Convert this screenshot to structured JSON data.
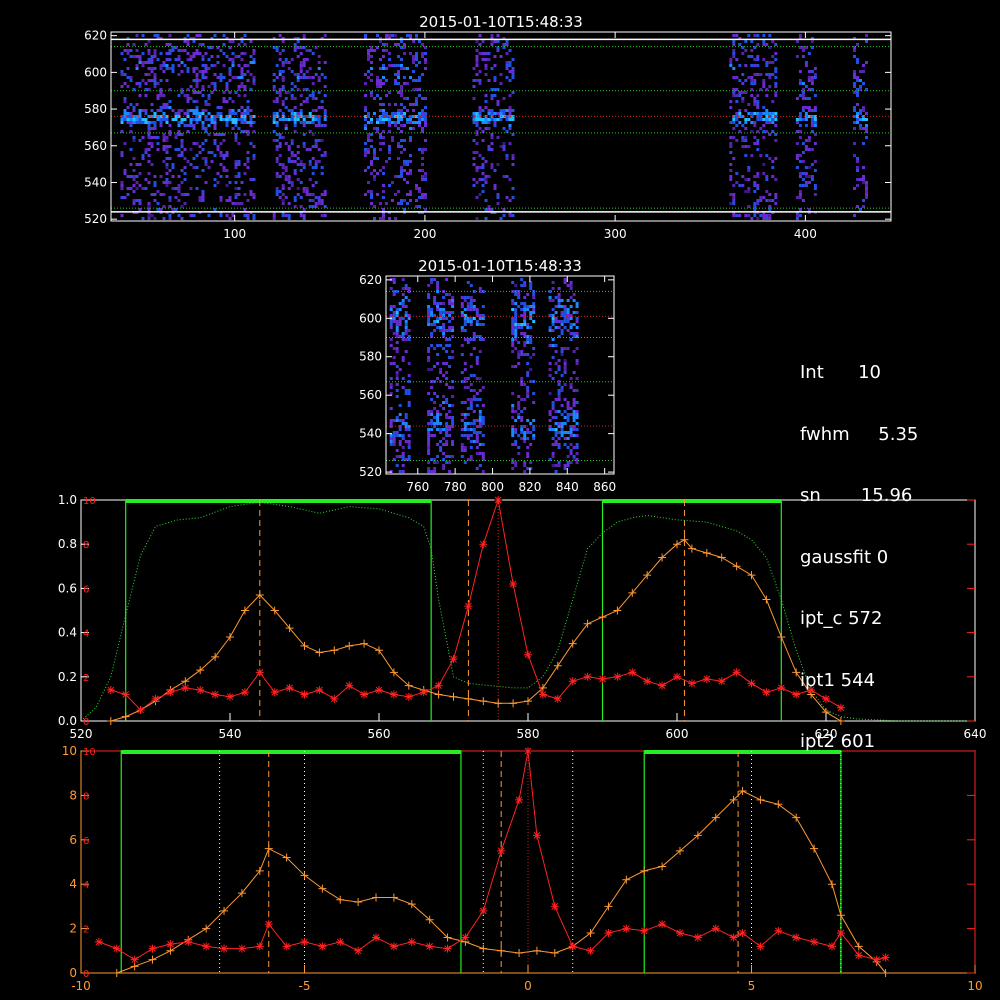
{
  "chart_data": [
    {
      "type": "heatmap",
      "title": "2015-01-10T15:48:33",
      "xlim": [
        35,
        445
      ],
      "ylim": [
        519,
        622
      ],
      "xticks": [
        100,
        200,
        300,
        400
      ],
      "yticks": [
        520,
        540,
        560,
        580,
        600,
        620
      ],
      "bands_x": [
        [
          40,
          110
        ],
        [
          120,
          148
        ],
        [
          168,
          200
        ],
        [
          225,
          247
        ],
        [
          360,
          385
        ],
        [
          395,
          406
        ],
        [
          425,
          432
        ]
      ],
      "horizontal_lines": [
        {
          "y": 618,
          "color": "#ffffff",
          "style": "solid"
        },
        {
          "y": 614,
          "color": "#22cc22",
          "style": "dotted"
        },
        {
          "y": 590,
          "color": "#22cc22",
          "style": "dotted"
        },
        {
          "y": 576,
          "color": "#cc2222",
          "style": "dotted"
        },
        {
          "y": 567,
          "color": "#22cc22",
          "style": "dotted"
        },
        {
          "y": 526,
          "color": "#22cc22",
          "style": "dotted"
        },
        {
          "y": 524,
          "color": "#ffffff",
          "style": "solid"
        }
      ]
    },
    {
      "type": "heatmap",
      "title": "2015-01-10T15:48:33",
      "xlim": [
        743,
        865
      ],
      "ylim": [
        519,
        622
      ],
      "xticks": [
        760,
        780,
        800,
        820,
        840,
        860
      ],
      "yticks": [
        520,
        540,
        560,
        580,
        600,
        620
      ],
      "bands_x": [
        [
          745,
          755
        ],
        [
          765,
          778
        ],
        [
          783,
          795
        ],
        [
          810,
          822
        ],
        [
          830,
          845
        ]
      ],
      "horizontal_lines": [
        {
          "y": 614,
          "color": "#22cc22",
          "style": "dotted"
        },
        {
          "y": 601,
          "color": "#cc2222",
          "style": "dotted"
        },
        {
          "y": 590,
          "color": "#22cc22",
          "style": "dotted"
        },
        {
          "y": 567,
          "color": "#22cc22",
          "style": "dotted"
        },
        {
          "y": 544,
          "color": "#cc2222",
          "style": "dotted"
        },
        {
          "y": 526,
          "color": "#22cc22",
          "style": "dotted"
        }
      ]
    },
    {
      "type": "line",
      "xlim": [
        520,
        640
      ],
      "ylim": [
        0,
        1.0
      ],
      "xticks": [
        520,
        540,
        560,
        580,
        600,
        620,
        640
      ],
      "yticks_left": [
        "0.0",
        "0.2",
        "0.4",
        "0.6",
        "0.8",
        "1.0"
      ],
      "yticks_right": [
        0,
        2,
        4,
        6,
        8,
        10
      ],
      "green_boxes": [
        [
          526,
          567
        ],
        [
          590,
          614
        ]
      ],
      "dashed_orange": [
        544,
        572,
        601
      ],
      "dotted_red": [
        576
      ],
      "series": [
        {
          "color": "#33dd33",
          "style": "dotted",
          "x": [
            520,
            522,
            524,
            526,
            528,
            530,
            533,
            536,
            540,
            544,
            548,
            552,
            556,
            560,
            562,
            564,
            566,
            567,
            568,
            570,
            572,
            575,
            578,
            580,
            582,
            584,
            586,
            588,
            590,
            592,
            594,
            596,
            600,
            604,
            608,
            610,
            612,
            614,
            616,
            618,
            620,
            622,
            624,
            630,
            640
          ],
          "y": [
            0.0,
            0.06,
            0.2,
            0.48,
            0.75,
            0.88,
            0.91,
            0.92,
            0.97,
            0.99,
            0.97,
            0.94,
            0.97,
            0.96,
            0.94,
            0.92,
            0.88,
            0.78,
            0.55,
            0.2,
            0.17,
            0.16,
            0.15,
            0.15,
            0.2,
            0.32,
            0.55,
            0.78,
            0.85,
            0.9,
            0.92,
            0.93,
            0.91,
            0.9,
            0.86,
            0.82,
            0.74,
            0.55,
            0.32,
            0.14,
            0.05,
            0.02,
            0.01,
            0.0,
            0.0
          ]
        },
        {
          "color": "#ff9933",
          "style": "plus",
          "x": [
            524,
            526,
            528,
            530,
            532,
            534,
            536,
            538,
            540,
            542,
            544,
            546,
            548,
            550,
            552,
            554,
            556,
            558,
            560,
            562,
            564,
            566,
            568,
            570,
            572,
            574,
            576,
            578,
            580,
            582,
            584,
            586,
            588,
            590,
            592,
            594,
            596,
            598,
            600,
            601,
            602,
            604,
            606,
            608,
            610,
            612,
            614,
            616,
            618,
            620,
            622
          ],
          "y": [
            0.0,
            0.02,
            0.05,
            0.09,
            0.14,
            0.18,
            0.23,
            0.29,
            0.38,
            0.5,
            0.57,
            0.5,
            0.42,
            0.34,
            0.31,
            0.32,
            0.34,
            0.35,
            0.32,
            0.22,
            0.16,
            0.14,
            0.12,
            0.11,
            0.1,
            0.09,
            0.08,
            0.08,
            0.09,
            0.15,
            0.25,
            0.35,
            0.44,
            0.47,
            0.5,
            0.58,
            0.66,
            0.74,
            0.8,
            0.82,
            0.78,
            0.76,
            0.74,
            0.7,
            0.66,
            0.55,
            0.38,
            0.22,
            0.12,
            0.04,
            0.0
          ]
        },
        {
          "color": "#ff2222",
          "style": "star",
          "x": [
            524,
            526,
            528,
            530,
            532,
            534,
            536,
            538,
            540,
            542,
            544,
            546,
            548,
            550,
            552,
            554,
            556,
            558,
            560,
            562,
            564,
            566,
            568,
            570,
            572,
            574,
            576,
            578,
            580,
            582,
            584,
            586,
            588,
            590,
            592,
            594,
            596,
            598,
            600,
            602,
            604,
            606,
            608,
            610,
            612,
            614,
            616,
            618,
            620,
            622
          ],
          "y": [
            0.14,
            0.12,
            0.05,
            0.1,
            0.13,
            0.15,
            0.14,
            0.12,
            0.11,
            0.13,
            0.22,
            0.13,
            0.15,
            0.12,
            0.14,
            0.1,
            0.16,
            0.12,
            0.14,
            0.12,
            0.11,
            0.13,
            0.16,
            0.28,
            0.52,
            0.8,
            1.0,
            0.62,
            0.3,
            0.12,
            0.1,
            0.18,
            0.2,
            0.19,
            0.2,
            0.22,
            0.18,
            0.16,
            0.2,
            0.17,
            0.19,
            0.18,
            0.22,
            0.17,
            0.13,
            0.15,
            0.12,
            0.14,
            0.1,
            0.06
          ]
        }
      ]
    },
    {
      "type": "line",
      "xlim": [
        -10,
        10
      ],
      "ylim": [
        0,
        10
      ],
      "xticks": [
        -10,
        -5,
        0,
        5,
        10
      ],
      "yticks_left": [
        0,
        2,
        4,
        6,
        8,
        10
      ],
      "yticks_right": [
        0,
        2,
        4,
        6,
        8,
        10
      ],
      "green_boxes": [
        [
          -9.1,
          -1.5
        ],
        [
          2.6,
          7.0
        ]
      ],
      "dashed_orange": [
        -5.8,
        -0.6,
        4.7
      ],
      "dotted_white": [
        -6.9,
        -5.0,
        -1.0,
        1.0,
        5.0,
        7.0
      ],
      "dotted_red": [
        0
      ],
      "series": [
        {
          "color": "#ff9933",
          "style": "plus",
          "x": [
            -9.2,
            -8.8,
            -8.4,
            -8.0,
            -7.6,
            -7.2,
            -6.8,
            -6.4,
            -6.0,
            -5.8,
            -5.4,
            -5.0,
            -4.6,
            -4.2,
            -3.8,
            -3.4,
            -3.0,
            -2.6,
            -2.2,
            -1.8,
            -1.4,
            -1.0,
            -0.6,
            -0.2,
            0.2,
            0.6,
            1.0,
            1.4,
            1.8,
            2.2,
            2.6,
            3.0,
            3.4,
            3.8,
            4.2,
            4.6,
            4.8,
            5.2,
            5.6,
            6.0,
            6.4,
            6.8,
            7.0,
            7.4,
            7.8,
            8.0
          ],
          "y": [
            0.0,
            0.3,
            0.6,
            1.0,
            1.5,
            2.0,
            2.8,
            3.6,
            4.6,
            5.6,
            5.2,
            4.4,
            3.8,
            3.3,
            3.2,
            3.4,
            3.4,
            3.1,
            2.4,
            1.6,
            1.4,
            1.1,
            1.0,
            0.9,
            1.0,
            0.9,
            1.2,
            1.8,
            3.0,
            4.2,
            4.6,
            4.8,
            5.5,
            6.2,
            7.0,
            7.8,
            8.2,
            7.8,
            7.6,
            7.0,
            5.6,
            4.0,
            2.6,
            1.2,
            0.5,
            0.0
          ]
        },
        {
          "color": "#ff2222",
          "style": "star",
          "x": [
            -9.6,
            -9.2,
            -8.8,
            -8.4,
            -8.0,
            -7.6,
            -7.2,
            -6.8,
            -6.4,
            -6.0,
            -5.8,
            -5.4,
            -5.0,
            -4.6,
            -4.2,
            -3.8,
            -3.4,
            -3.0,
            -2.6,
            -2.2,
            -1.8,
            -1.4,
            -1.0,
            -0.6,
            -0.2,
            0.0,
            0.2,
            0.6,
            1.0,
            1.4,
            1.8,
            2.2,
            2.6,
            3.0,
            3.4,
            3.8,
            4.2,
            4.6,
            4.8,
            5.2,
            5.6,
            6.0,
            6.4,
            6.8,
            7.0,
            7.4,
            7.8,
            8.0
          ],
          "y": [
            1.4,
            1.1,
            0.6,
            1.1,
            1.3,
            1.4,
            1.2,
            1.1,
            1.1,
            1.2,
            2.2,
            1.2,
            1.4,
            1.2,
            1.4,
            1.0,
            1.6,
            1.2,
            1.4,
            1.2,
            1.1,
            1.6,
            2.8,
            5.5,
            7.8,
            10.0,
            6.2,
            3.0,
            1.2,
            1.0,
            1.8,
            2.0,
            1.9,
            2.2,
            1.8,
            1.6,
            2.0,
            1.6,
            1.8,
            1.2,
            1.9,
            1.6,
            1.4,
            1.2,
            1.8,
            0.8,
            0.6,
            0.7
          ]
        }
      ]
    }
  ],
  "info": {
    "lines": [
      "Int      10",
      "fwhm     5.35",
      "sn       15.96",
      "gaussfit 0",
      "ipt_c 572",
      "ipt1 544",
      "ipt2 601"
    ]
  },
  "colors": {
    "axes": "#ffffff",
    "axes_red": "#ff2222",
    "axes_orange": "#ff9933",
    "green": "#22ee22"
  }
}
